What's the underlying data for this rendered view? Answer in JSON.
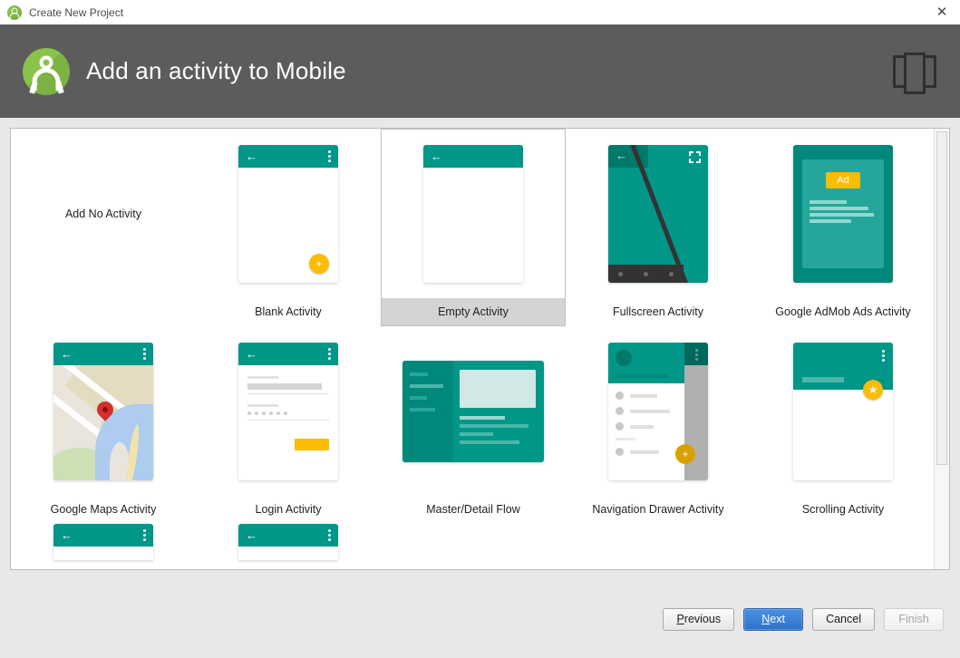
{
  "window": {
    "title": "Create New Project",
    "icon": "android-studio-icon",
    "close_icon": "close-icon"
  },
  "header": {
    "title": "Add an activity to Mobile",
    "logo": "android-studio-logo",
    "form_factor_icon": "tablet-device-icon",
    "background": "#5c5c5c"
  },
  "colors": {
    "teal": "#009688",
    "teal_dark": "#00796b",
    "teal_light": "#26a69a",
    "amber": "#fbbc05",
    "accent_blue": "#2f72c9",
    "selection_gray": "#d4d4d4"
  },
  "gallery": {
    "selected": "Empty Activity",
    "columns": 5,
    "items": [
      {
        "label": "Add No Activity",
        "thumb": "none"
      },
      {
        "label": "Blank Activity",
        "thumb": "blank"
      },
      {
        "label": "Empty Activity",
        "thumb": "empty",
        "selected": true
      },
      {
        "label": "Fullscreen Activity",
        "thumb": "fullscreen"
      },
      {
        "label": "Google AdMob Ads Activity",
        "thumb": "admob",
        "badge": "Ad"
      },
      {
        "label": "Google Maps Activity",
        "thumb": "maps"
      },
      {
        "label": "Login Activity",
        "thumb": "login"
      },
      {
        "label": "Master/Detail Flow",
        "thumb": "masterdetail"
      },
      {
        "label": "Navigation Drawer Activity",
        "thumb": "navdrawer"
      },
      {
        "label": "Scrolling Activity",
        "thumb": "scrolling"
      }
    ],
    "partial_row_visible": true
  },
  "scrollbar": {
    "orientation": "vertical",
    "thumb_position": "top"
  },
  "footer": {
    "buttons": [
      {
        "name": "previous",
        "label": "Previous",
        "accel": "P",
        "state": "enabled"
      },
      {
        "name": "next",
        "label": "Next",
        "accel": "N",
        "state": "default"
      },
      {
        "name": "cancel",
        "label": "Cancel",
        "accel": "",
        "state": "enabled"
      },
      {
        "name": "finish",
        "label": "Finish",
        "accel": "",
        "state": "disabled"
      }
    ]
  }
}
